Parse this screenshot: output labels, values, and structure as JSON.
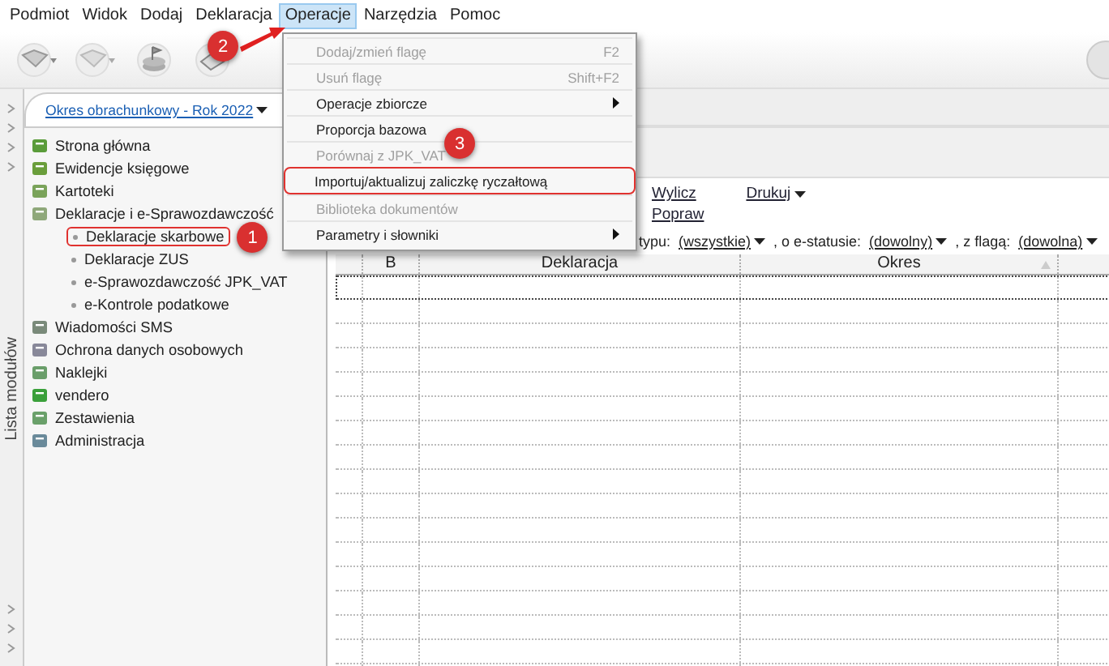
{
  "menu_bar": [
    {
      "label": "Podmiot",
      "selected": false
    },
    {
      "label": "Widok",
      "selected": false
    },
    {
      "label": "Dodaj",
      "selected": false
    },
    {
      "label": "Deklaracja",
      "selected": false
    },
    {
      "label": "Operacje",
      "selected": true,
      "callout": "2"
    },
    {
      "label": "Narzędzia",
      "selected": false
    },
    {
      "label": "Pomoc",
      "selected": false
    }
  ],
  "dropdown": {
    "items": [
      {
        "label": "Dodaj/zmień flagę",
        "shortcut": "F2",
        "disabled": true,
        "submenu": false
      },
      {
        "label": "Usuń flagę",
        "shortcut": "Shift+F2",
        "disabled": true,
        "submenu": false
      },
      {
        "label": "Operacje zbiorcze",
        "disabled": false,
        "submenu": true
      },
      {
        "label": "Proporcja bazowa",
        "disabled": false,
        "submenu": false
      },
      {
        "label": "Porównaj z JPK_VAT",
        "disabled": true,
        "submenu": false
      },
      {
        "label": "Importuj/aktualizuj zaliczkę ryczałtową",
        "disabled": false,
        "submenu": false,
        "callout": "3"
      },
      {
        "label": "Biblioteka dokumentów",
        "disabled": true,
        "submenu": false
      },
      {
        "label": "Parametry i słowniki",
        "disabled": false,
        "submenu": true
      }
    ]
  },
  "period_tab": {
    "label": "Okres obrachunkowy - Rok 2022"
  },
  "sidebar": {
    "title": "Lista modułów",
    "items": [
      {
        "label": "Strona główna"
      },
      {
        "label": "Ewidencje księgowe"
      },
      {
        "label": "Kartoteki"
      },
      {
        "label": "Deklaracje i e-Sprawozdawczość",
        "children": [
          {
            "label": "Deklaracje skarbowe",
            "callout": "1"
          },
          {
            "label": "Deklaracje ZUS"
          },
          {
            "label": "e-Sprawozdawczość JPK_VAT"
          },
          {
            "label": "e-Kontrole podatkowe"
          }
        ]
      },
      {
        "label": "Wiadomości SMS"
      },
      {
        "label": "Ochrona danych osobowych"
      },
      {
        "label": "Naklejki"
      },
      {
        "label": "vendero"
      },
      {
        "label": "Zestawienia"
      },
      {
        "label": "Administracja"
      }
    ]
  },
  "actions": [
    {
      "items": [
        "Wylicz",
        "Popraw"
      ],
      "dropdown": false
    },
    {
      "items": [
        "Drukuj"
      ],
      "dropdown": true
    }
  ],
  "filters": [
    {
      "kind": "label",
      "text": "typu:"
    },
    {
      "kind": "choice",
      "text": "(wszystkie)"
    },
    {
      "kind": "label",
      "text": ", o e-statusie:"
    },
    {
      "kind": "choice",
      "text": "(dowolny)"
    },
    {
      "kind": "label",
      "text": ", z flagą:"
    },
    {
      "kind": "choice",
      "text": "(dowolna)"
    }
  ],
  "table": {
    "columns": [
      {
        "label": "B",
        "sorted": false
      },
      {
        "label": "Deklaracja",
        "sorted": false
      },
      {
        "label": "Okres",
        "sorted": true
      }
    ]
  }
}
